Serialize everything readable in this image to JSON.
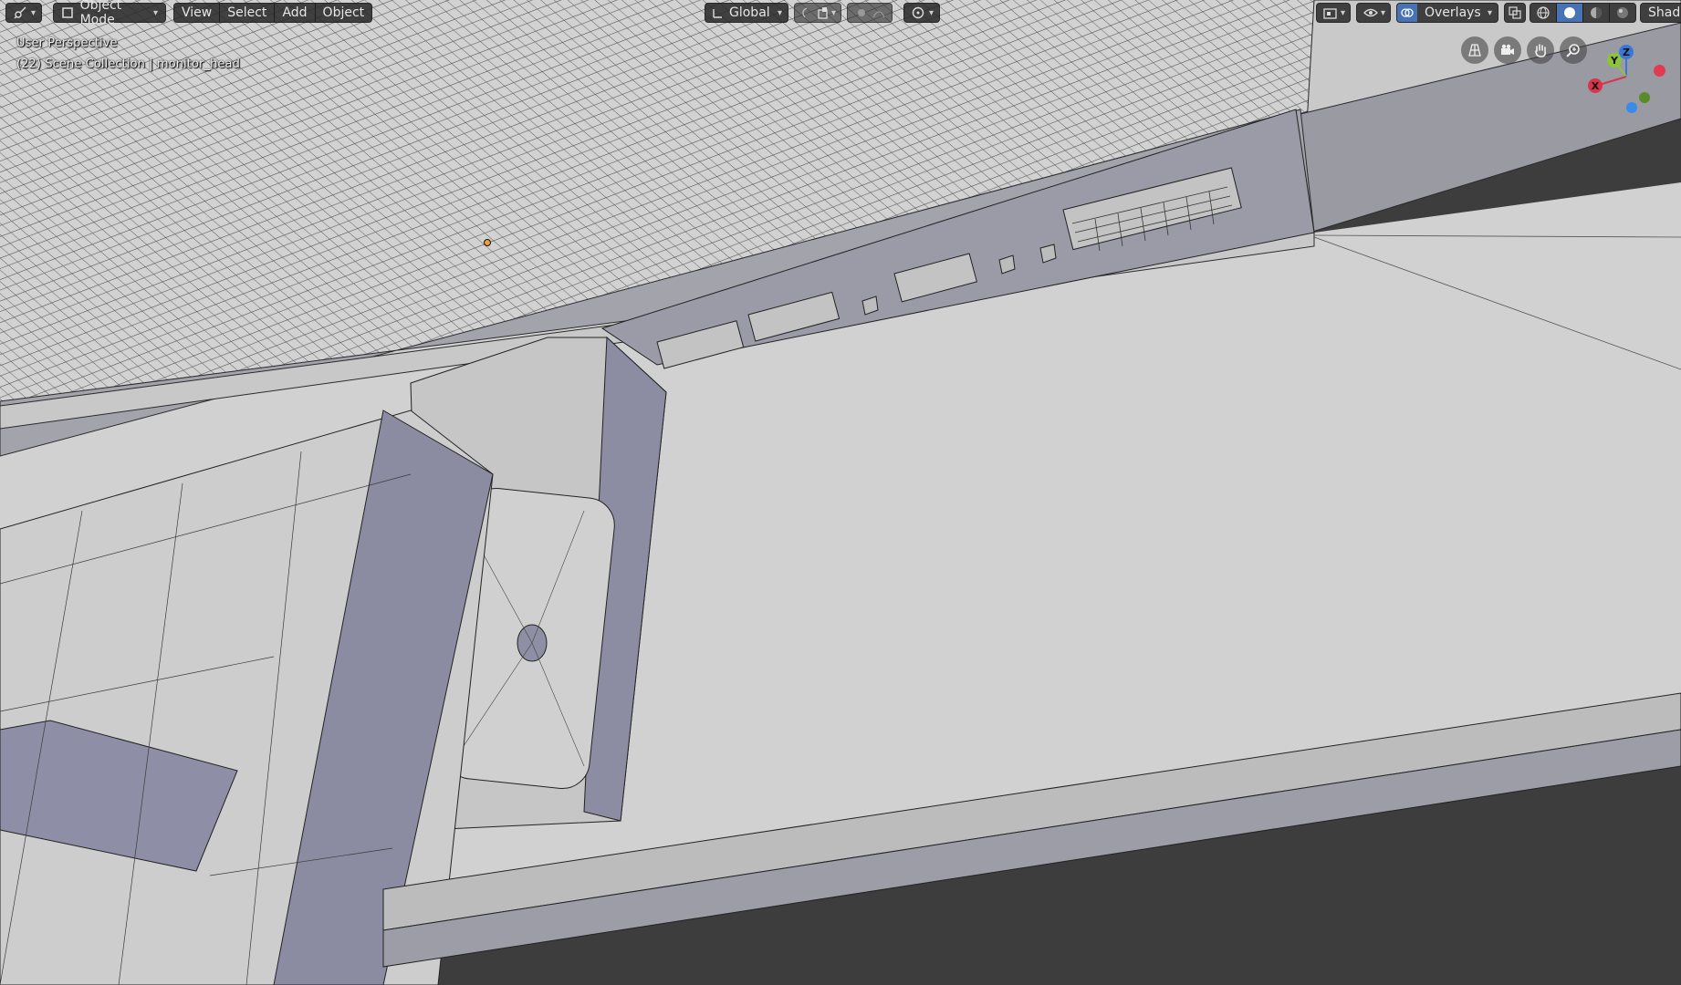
{
  "app": {
    "editor_type_icon": "3d-viewport-icon",
    "colors": {
      "viewport_bg": "#3d3d3d",
      "mesh_light": "#d4d4d4",
      "mesh_dark": "#8e8ea4",
      "wire": "#2a2a2a",
      "header_bg": "#282828",
      "accent_blue": "#4772b3",
      "axis_x": "#d8344a",
      "axis_y": "#8bc43a",
      "axis_z": "#3a78d8"
    }
  },
  "header_left": {
    "mode_label": "Object Mode",
    "menu": [
      "View",
      "Select",
      "Add",
      "Object"
    ]
  },
  "header_center": {
    "orientation_label": "Global",
    "pivot_icon": "pivot-point-icon",
    "snap_icon": "magnet-icon",
    "proportional_icon": "proportional-edit-icon"
  },
  "header_right": {
    "overlays_label": "Overlays",
    "shading_label": "Shading",
    "shading_modes": [
      "wireframe",
      "solid",
      "material",
      "rendered"
    ],
    "active_shading": "solid"
  },
  "overlay_info": {
    "perspective": "User Perspective",
    "collection": "(22) Scene Collection | monitor_head"
  },
  "navigation": {
    "buttons": [
      "ortho-toggle-icon",
      "camera-icon",
      "hand-pan-icon",
      "zoom-icon"
    ],
    "gizmo_axes": {
      "x": "X",
      "y": "Y",
      "z": "Z"
    }
  }
}
